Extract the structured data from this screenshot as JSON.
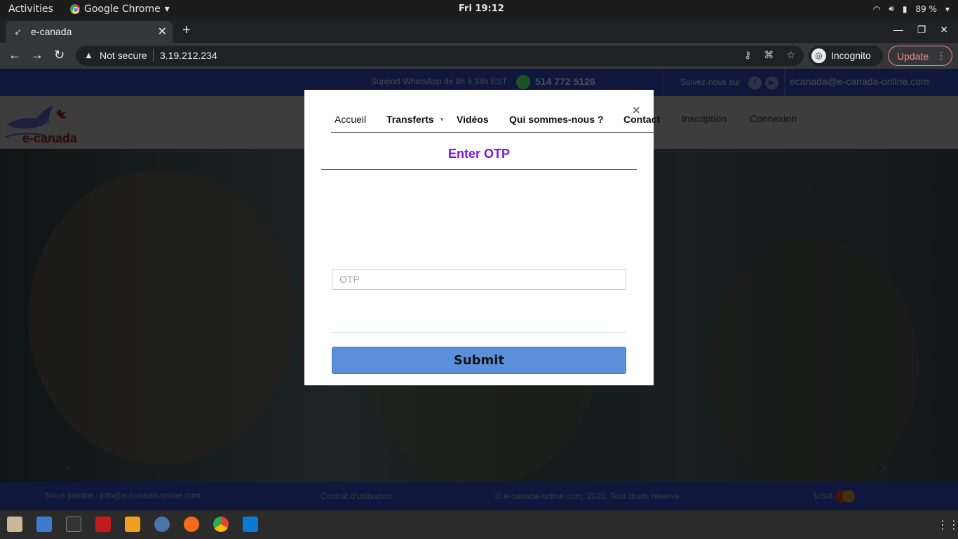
{
  "system": {
    "activities": "Activities",
    "app_name": "Google Chrome",
    "clock": "Fri 19:12",
    "battery": "89 %"
  },
  "browser": {
    "tab_title": "e-canada",
    "security_label": "Not secure",
    "url": "3.19.212.234",
    "incognito_label": "Incognito",
    "update_label": "Update"
  },
  "site": {
    "support_text": "Support WhatsApp de 8h à 18h EST",
    "phone": "514 772 5126",
    "follow_text": "Suivez-nous sur",
    "email": "ecanada@e-canada-online.com",
    "logo_text": "e-canada",
    "nav": {
      "accueil": "Accueil",
      "transferts": "Transferts",
      "videos": "Vidéos",
      "qui": "Qui sommes-nous ?",
      "contact": "Contact",
      "inscription": "Inscription",
      "connexion": "Connexion"
    },
    "footer": {
      "join": "Nous joindre : info@e-canada-online.com",
      "terms": "Contrat d'utilisation",
      "copyright": "© e-canada-online.com, 2020. Tout droits réservé",
      "visa": "VISA"
    }
  },
  "modal": {
    "close": "×",
    "title": "Enter OTP",
    "otp_placeholder": "OTP",
    "submit_label": "Submit"
  },
  "colors": {
    "brand_blue": "#1e3078",
    "otp_title": "#7b16e8",
    "submit_bg": "#5b8fd9"
  }
}
